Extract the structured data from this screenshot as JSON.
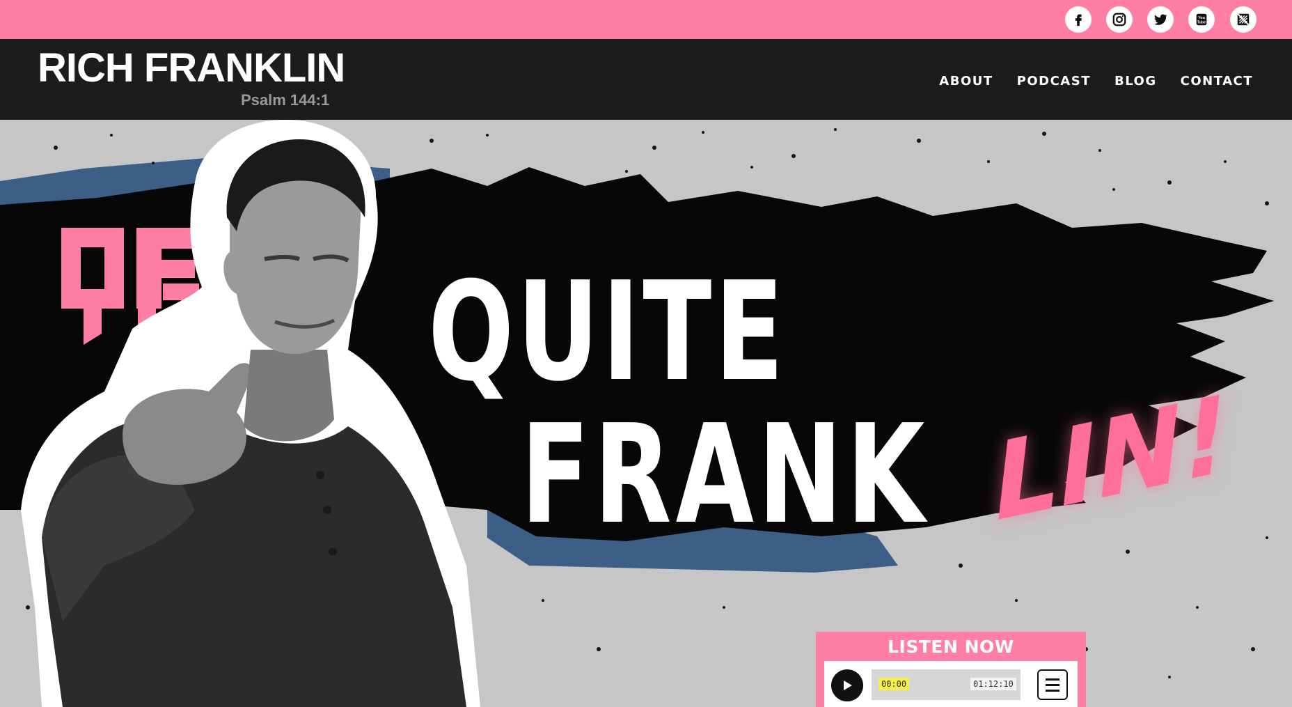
{
  "social": [
    {
      "name": "facebook-icon"
    },
    {
      "name": "instagram-icon"
    },
    {
      "name": "twitter-icon"
    },
    {
      "name": "youtube-icon"
    },
    {
      "name": "podcast-icon"
    }
  ],
  "header": {
    "brand_name": "RICH FRANKLIN",
    "brand_tagline": "Psalm 144:1"
  },
  "nav": {
    "items": [
      "ABOUT",
      "PODCAST",
      "BLOG",
      "CONTACT"
    ]
  },
  "hero": {
    "title_line1": "QUITE",
    "title_line2": "FRANK",
    "title_accent": "LIN!"
  },
  "player": {
    "title": "LISTEN NOW",
    "current_time": "00:00",
    "total_time": "01:12:10"
  },
  "colors": {
    "accent_pink": "#ff7fa4",
    "header_dark": "#1c1c1c",
    "brush_blue": "#3d5e86",
    "hero_grey": "#c6c6c6"
  }
}
